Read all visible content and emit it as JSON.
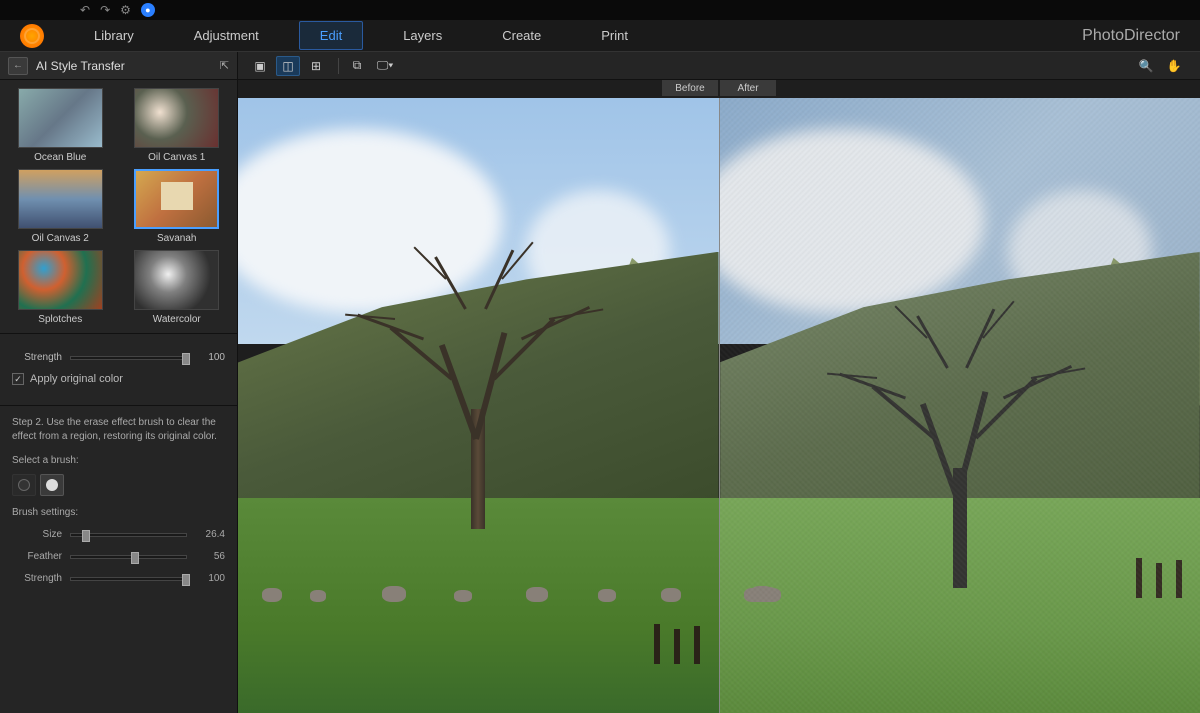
{
  "app": {
    "name": "PhotoDirector"
  },
  "nav": {
    "items": [
      {
        "label": "Library",
        "active": false
      },
      {
        "label": "Adjustment",
        "active": false
      },
      {
        "label": "Edit",
        "active": true
      },
      {
        "label": "Layers",
        "active": false
      },
      {
        "label": "Create",
        "active": false
      },
      {
        "label": "Print",
        "active": false
      }
    ]
  },
  "sidebar": {
    "title": "AI Style Transfer",
    "styles": [
      {
        "label": "Ocean Blue",
        "selected": false
      },
      {
        "label": "Oil Canvas 1",
        "selected": false
      },
      {
        "label": "Oil Canvas 2",
        "selected": false
      },
      {
        "label": "Savanah",
        "selected": true
      },
      {
        "label": "Splotches",
        "selected": false
      },
      {
        "label": "Watercolor",
        "selected": false
      }
    ],
    "strength": {
      "label": "Strength",
      "value": 100
    },
    "apply_color": {
      "label": "Apply original color",
      "checked": true
    },
    "step2": {
      "text": "Step 2. Use the erase effect brush to clear the effect from a region, restoring its original color.",
      "select_brush": "Select a brush:",
      "settings_label": "Brush settings:",
      "size": {
        "label": "Size",
        "value": 26.4
      },
      "feather": {
        "label": "Feather",
        "value": 56
      },
      "strength": {
        "label": "Strength",
        "value": 100
      }
    }
  },
  "canvas": {
    "before_label": "Before",
    "after_label": "After"
  }
}
